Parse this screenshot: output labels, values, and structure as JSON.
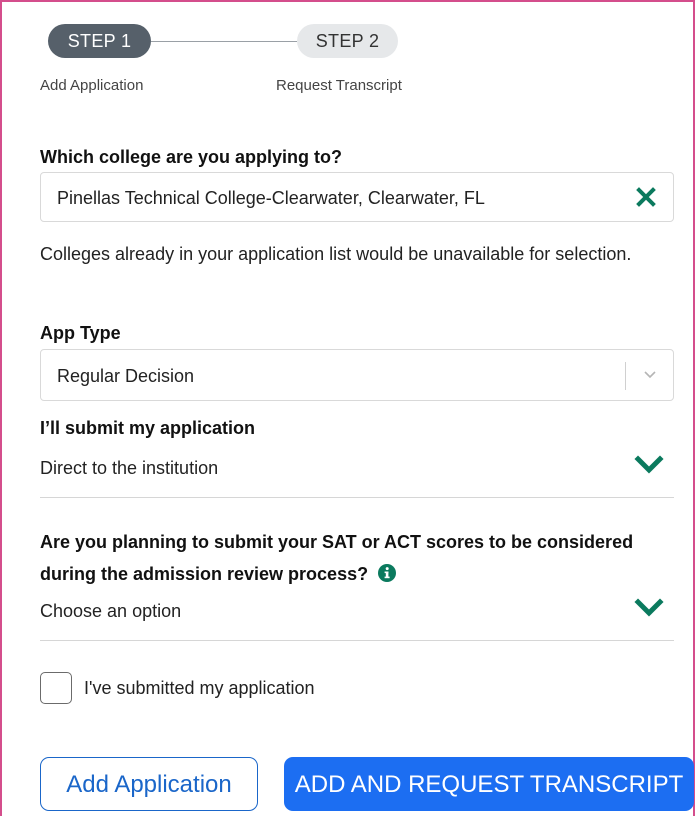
{
  "stepper": {
    "steps": [
      {
        "label": "STEP 1",
        "caption": "Add Application",
        "active": true
      },
      {
        "label": "STEP 2",
        "caption": "Request Transcript",
        "active": false
      }
    ]
  },
  "form": {
    "college": {
      "label": "Which college are you applying to?",
      "value": "Pinellas Technical College-Clearwater, Clearwater, FL",
      "helper": "Colleges already in your application list would be unavailable for selection."
    },
    "app_type": {
      "label": "App Type",
      "value": "Regular Decision"
    },
    "submission": {
      "label": "I’ll submit my application",
      "value": "Direct to the institution"
    },
    "test_scores": {
      "label": "Are you planning to submit your SAT or ACT scores to be considered during the admission review process?",
      "value": "Choose an option"
    },
    "submitted_checkbox": {
      "label": "I've submitted my application",
      "checked": false
    }
  },
  "actions": {
    "add_application": "Add Application",
    "add_and_request": "ADD AND REQUEST TRANSCRIPT"
  },
  "colors": {
    "accent_green": "#0b7a5e",
    "primary_blue": "#1c6ef2",
    "active_step": "#56606a",
    "frame_border": "#d44e8c"
  },
  "icons": {
    "clear": "close-icon",
    "dropdown": "chevron-down-icon",
    "info": "info-icon"
  }
}
